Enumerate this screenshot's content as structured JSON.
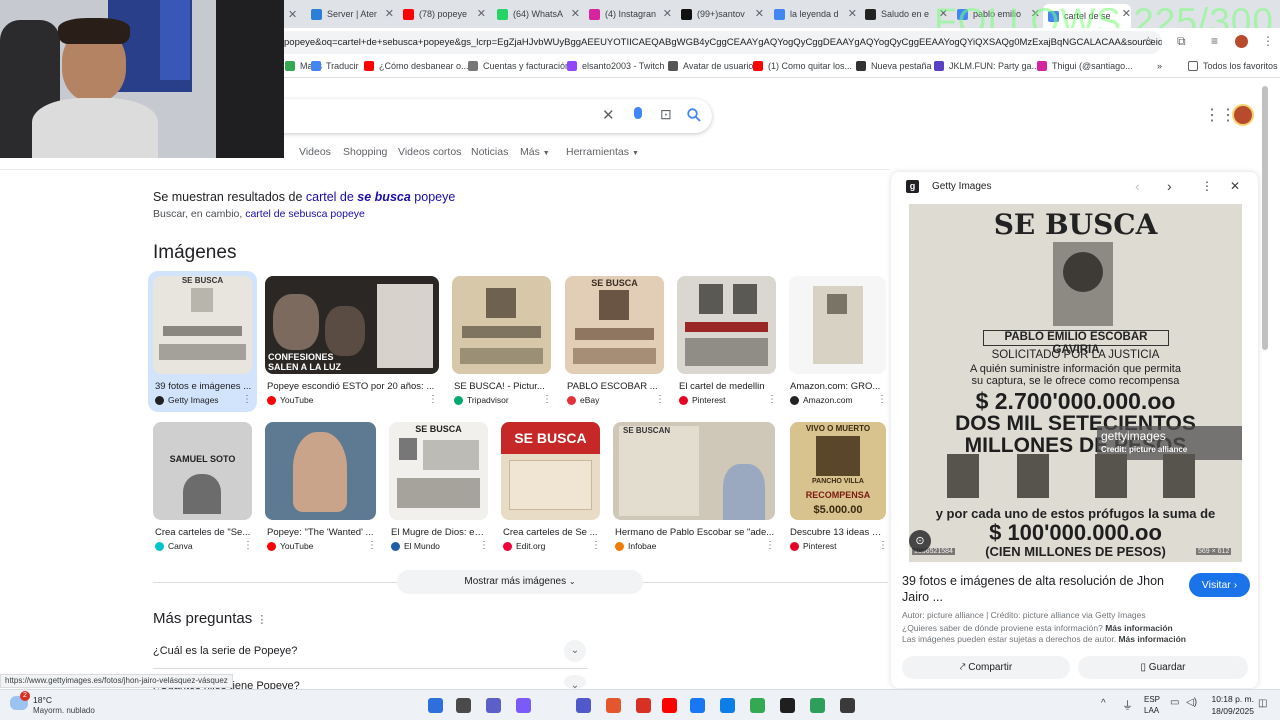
{
  "browser": {
    "tabs": [
      {
        "label": "Server | Ater",
        "color": "#2d7fd6"
      },
      {
        "label": "(78) popeye",
        "color": "#ff0000"
      },
      {
        "label": "(64) WhatsA",
        "color": "#25d366"
      },
      {
        "label": "(4) Instagran",
        "color": "#d6249f"
      },
      {
        "label": "(99+)santov",
        "color": "#111111"
      },
      {
        "label": "la leyenda d",
        "color": "#4285f4"
      },
      {
        "label": "Saludo en e",
        "color": "#222222"
      },
      {
        "label": "pablo emilio",
        "color": "#4285f4"
      },
      {
        "label": "cartel de se",
        "color": "#4285f4"
      }
    ],
    "overlay_text": "FOLLOWS 225/300",
    "url": "popeye&oq=cartel+de+sebusca+popeye&gs_lcrp=EgZjaHJvbWUyBggAEEUYOTIICAEQABgWGB4yCggCEAAYgAQYogQyCggDEAAYgAQYogQyCggEEAAYogQYiQXSAQg0MzExajBqNGCALACAA&sourceid=c...",
    "bookmarks": [
      {
        "label": "Maps",
        "color": "#34a853"
      },
      {
        "label": "Traducir",
        "color": "#4285f4"
      },
      {
        "label": "¿Cómo desbanear o...",
        "color": "#ff0000"
      },
      {
        "label": "Cuentas y facturación",
        "color": "#777777"
      },
      {
        "label": "elsanto2003 - Twitch",
        "color": "#9146ff"
      },
      {
        "label": "Avatar de usuario",
        "color": "#555555"
      },
      {
        "label": "(1) Como quitar los...",
        "color": "#ff0000"
      },
      {
        "label": "Nueva pestaña",
        "color": "#333333"
      },
      {
        "label": "JKLM.FUN: Party ga...",
        "color": "#5b3fc4"
      },
      {
        "label": "Thigui (@santiago...",
        "color": "#d6249f"
      }
    ],
    "all_bookmarks": "Todos los favoritos",
    "overflow": "»"
  },
  "search": {
    "nav": [
      "Videos",
      "Shopping",
      "Videos cortos",
      "Noticias",
      "Más",
      "Herramientas"
    ],
    "showing_prefix": "Se muestran resultados de ",
    "showing_link_a": "cartel de ",
    "showing_link_b": "se busca",
    "showing_link_c": " popeye",
    "instead_prefix": "Buscar, en cambio, ",
    "instead_link": "cartel de sebusca popeye",
    "images_heading": "Imágenes",
    "row1": [
      {
        "title": "39 fotos e imágenes ...",
        "source": "Getty Images",
        "color": "#202124"
      },
      {
        "title": "Popeye escondió ESTO por 20 años: ...",
        "source": "YouTube",
        "color": "#ff0000"
      },
      {
        "title": "SE BUSCA! - Pictur...",
        "source": "Tripadvisor",
        "color": "#00aa6c"
      },
      {
        "title": "PABLO ESCOBAR ...",
        "source": "eBay",
        "color": "#e53238"
      },
      {
        "title": "El cartel de medellin",
        "source": "Pinterest",
        "color": "#e60023"
      },
      {
        "title": "Amazon.com: GRO...",
        "source": "Amazon.com",
        "color": "#222222"
      }
    ],
    "row2": [
      {
        "title": "Crea carteles de \"Se...",
        "source": "Canva",
        "color": "#00c4cc"
      },
      {
        "title": "Popeye: \"The 'Wanted' ...",
        "source": "YouTube",
        "color": "#ff0000"
      },
      {
        "title": "El Mugre de Dios: el ...",
        "source": "El Mundo",
        "color": "#1f5fa8"
      },
      {
        "title": "Crea carteles de Se ...",
        "source": "Edit.org",
        "color": "#f1003c"
      },
      {
        "title": "Hermano de Pablo Escobar se \"ade...",
        "source": "Infobae",
        "color": "#f07c00"
      },
      {
        "title": "Descubre 13 ideas d...",
        "source": "Pinterest",
        "color": "#e60023"
      }
    ],
    "thumb_texts": {
      "sebusca": "SE BUSCA",
      "confesiones": "CONFESIONES",
      "salen": "SALEN A LA LUZ",
      "samuel": "SAMUEL SOTO",
      "sebuscan": "SE BUSCAN",
      "vivo": "VIVO O MUERTO",
      "pancho": "PANCHO VILLA",
      "recompensa": "RECOMPENSA",
      "amount": "$5.000.00"
    },
    "show_more": "Mostrar más imágenes",
    "more_questions": "Más preguntas",
    "questions": [
      "¿Cuál es la serie de Popeye?",
      "¿Cuántos hijos tiene Popeye?"
    ],
    "status_url": "https://www.gettyimages.es/fotos/jhon-jairo-velásquez-vásquez"
  },
  "panel": {
    "source": "Getty Images",
    "poster": {
      "header": "SE BUSCA",
      "name": "PABLO EMILIO ESCOBAR GAVIRIA",
      "solicitado": "SOLICITADO POR LA JUSTICIA",
      "line1": "A quién suministre información que permita",
      "line2": "su captura, se le ofrece como recompensa",
      "amount": "$ 2.700'000.000.oo",
      "words1": "DOS MIL SETECIENTOS",
      "words2": "MILLONES DE PESOS",
      "footer1": "y por cada uno de estos prófugos la suma de",
      "footer_amount": "$ 100'000.000.oo",
      "footer_words": "(CIEN MILLONES DE PESOS)",
      "wm_brand": "gettyimages",
      "wm_credit": "Credit: picture alliance",
      "image_id": "1036521584",
      "dims": "569 × 612"
    },
    "title": "39 fotos e imágenes de alta resolución de Jhon Jairo ...",
    "visit": "Visitar",
    "author": "Autor: picture alliance | Crédito: picture alliance via Getty Images",
    "where": "¿Quieres saber de dónde proviene esta información?",
    "where_link": "Más información",
    "rights": "Las imágenes pueden estar sujetas a derechos de autor.",
    "rights_link": "Más información",
    "share": "Compartir",
    "save": "Guardar"
  },
  "taskbar": {
    "weather_temp": "18°C",
    "weather_desc": "Mayorm. nublado",
    "notif_badge": "2",
    "lang1": "ESP",
    "lang2": "LAA",
    "time": "10:18 p. m.",
    "date": "18/09/2025"
  }
}
